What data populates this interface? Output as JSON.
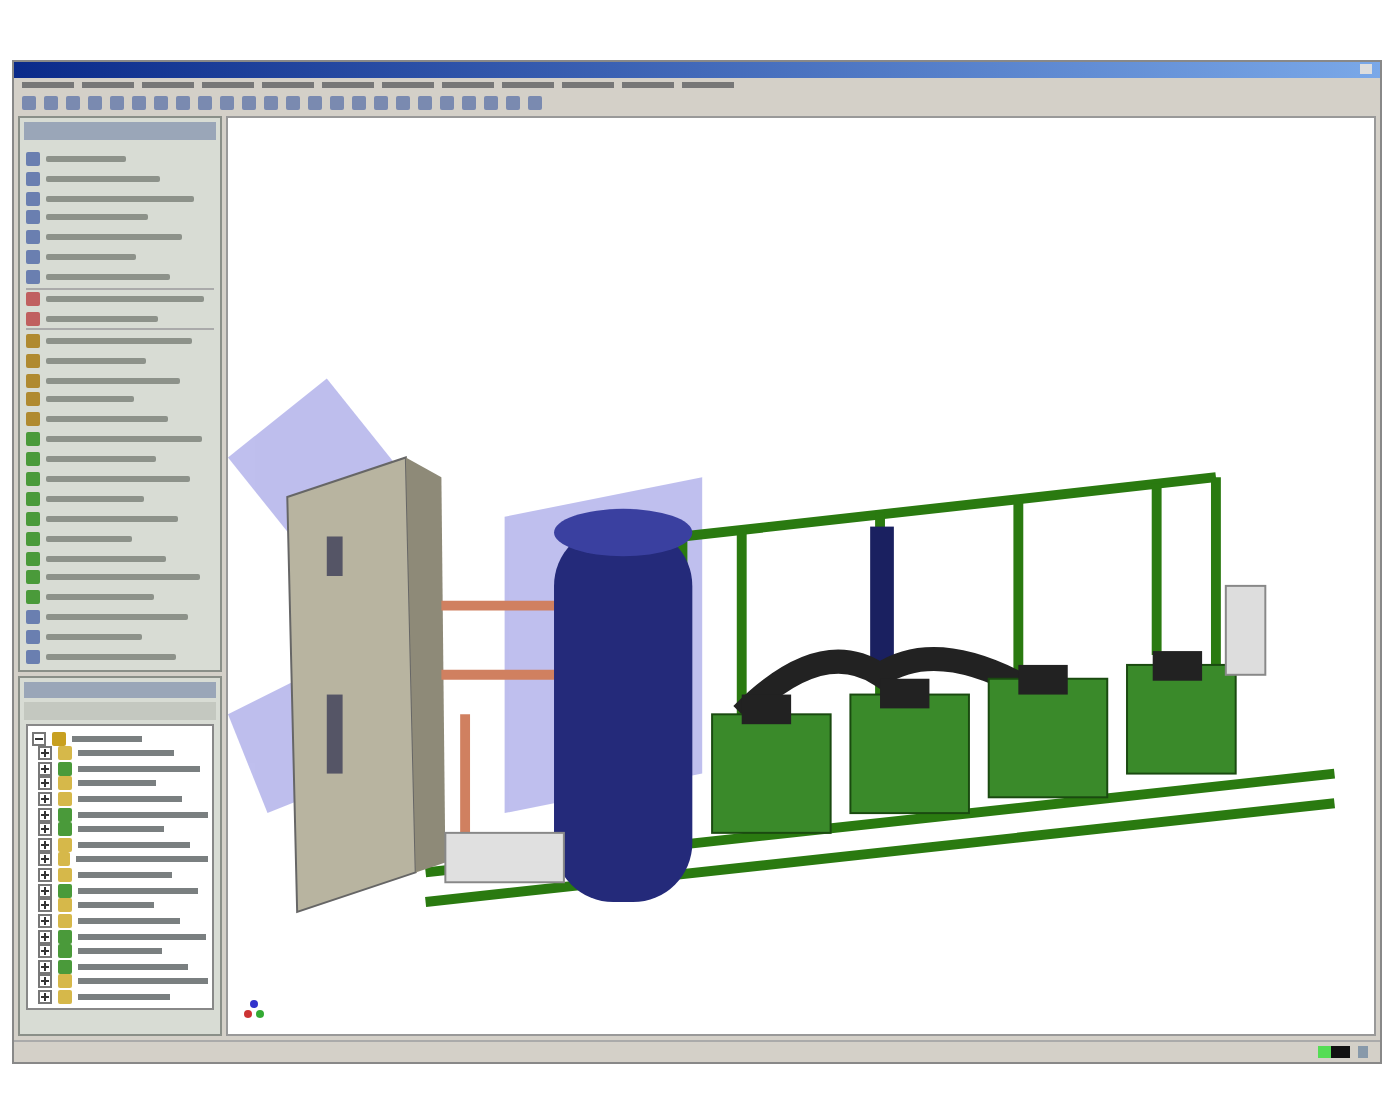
{
  "feature_panel": {
    "items": [
      {
        "kind": "tool"
      },
      {
        "kind": "tool"
      },
      {
        "kind": "tool"
      },
      {
        "kind": "tool"
      },
      {
        "kind": "tool"
      },
      {
        "kind": "tool"
      },
      {
        "kind": "tool"
      },
      {
        "kind": "sketch"
      },
      {
        "kind": "sketch"
      },
      {
        "kind": "feature"
      },
      {
        "kind": "feature"
      },
      {
        "kind": "feature"
      },
      {
        "kind": "feature"
      },
      {
        "kind": "feature"
      },
      {
        "kind": "part"
      },
      {
        "kind": "part"
      },
      {
        "kind": "part"
      },
      {
        "kind": "part"
      },
      {
        "kind": "part"
      },
      {
        "kind": "part"
      },
      {
        "kind": "part"
      },
      {
        "kind": "part"
      },
      {
        "kind": "part"
      },
      {
        "kind": "tool"
      },
      {
        "kind": "tool"
      },
      {
        "kind": "tool"
      }
    ]
  },
  "tree_panel": {
    "rows": [
      {
        "kind": "root",
        "expanded": true
      },
      {
        "kind": "assembly",
        "expanded": false
      },
      {
        "kind": "part",
        "expanded": false
      },
      {
        "kind": "assembly",
        "expanded": false
      },
      {
        "kind": "assembly",
        "expanded": false
      },
      {
        "kind": "part",
        "expanded": false
      },
      {
        "kind": "part",
        "expanded": false
      },
      {
        "kind": "assembly",
        "expanded": false
      },
      {
        "kind": "assembly",
        "expanded": false
      },
      {
        "kind": "assembly",
        "expanded": false
      },
      {
        "kind": "part",
        "expanded": false
      },
      {
        "kind": "assembly",
        "expanded": false
      },
      {
        "kind": "assembly",
        "expanded": false
      },
      {
        "kind": "part",
        "expanded": false
      },
      {
        "kind": "part",
        "expanded": false
      },
      {
        "kind": "part",
        "expanded": false
      },
      {
        "kind": "assembly",
        "expanded": false
      },
      {
        "kind": "assembly",
        "expanded": false
      }
    ]
  }
}
